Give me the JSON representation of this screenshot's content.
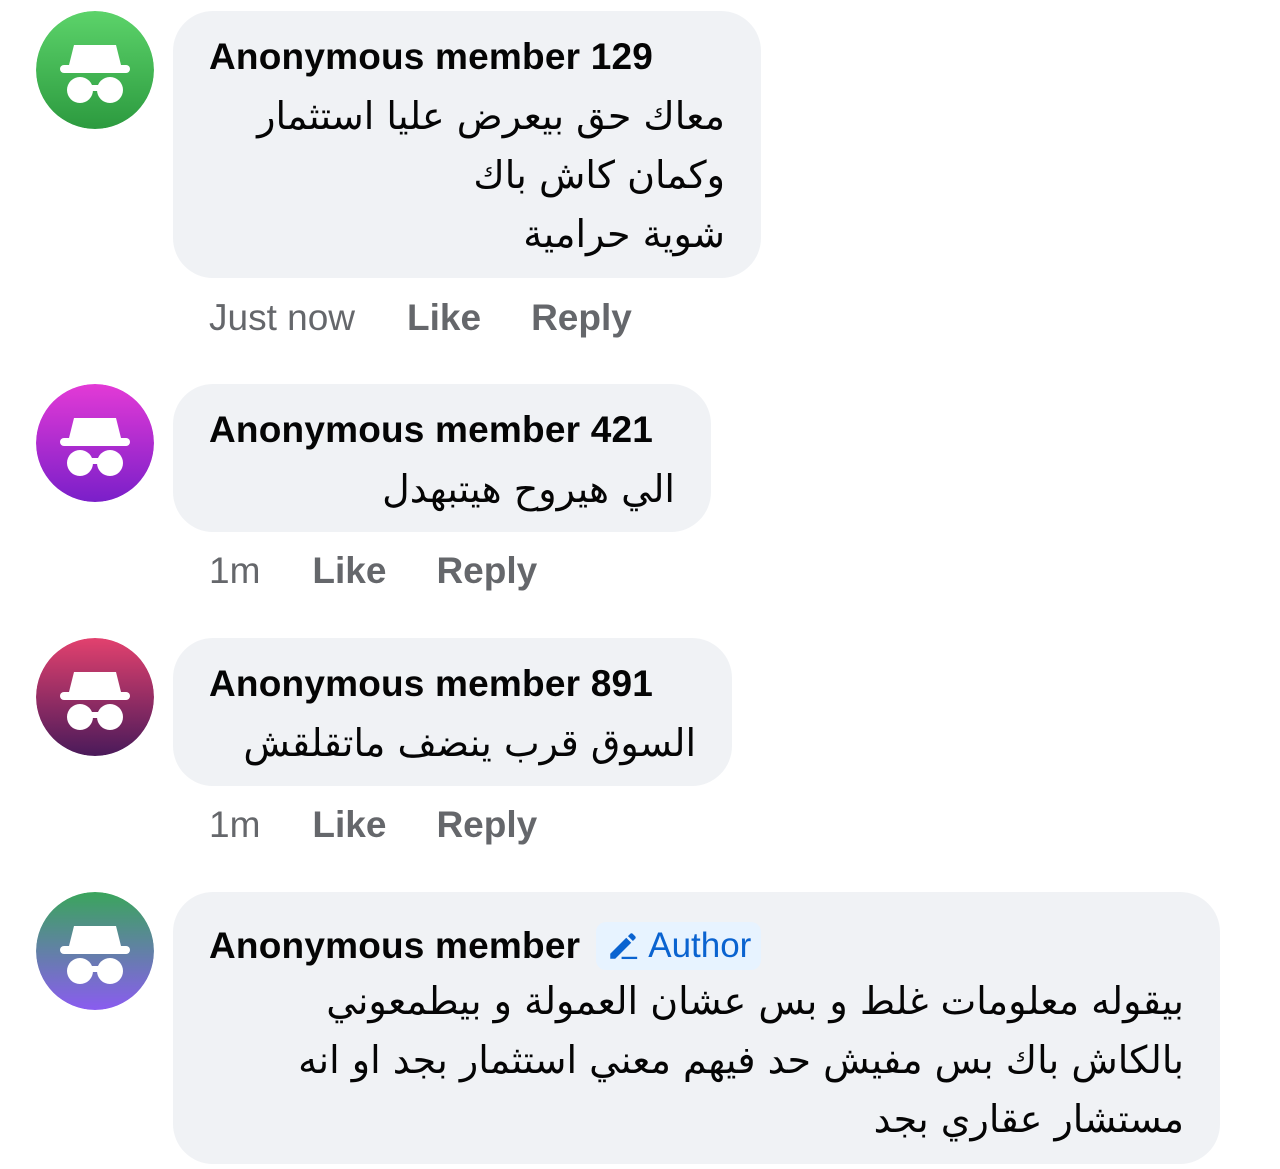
{
  "comments": [
    {
      "author": "Anonymous member 129",
      "lines": [
        "معاك حق بيعرض عليا استثمار",
        "وكمان كاش باك",
        "شوية حرامية"
      ],
      "time": "Just now",
      "like": "Like",
      "reply": "Reply",
      "avatar_colors": [
        "#5cd36a",
        "#2c9a3f"
      ]
    },
    {
      "author": "Anonymous member 421",
      "lines": [
        "الي هيروح هيتبهدل"
      ],
      "time": "1m",
      "like": "Like",
      "reply": "Reply",
      "avatar_colors": [
        "#e33ad6",
        "#7a1fc9"
      ]
    },
    {
      "author": "Anonymous member 891",
      "lines": [
        "السوق قرب ينضف ماتقلقش"
      ],
      "time": "1m",
      "like": "Like",
      "reply": "Reply",
      "avatar_colors": [
        "#e2416e",
        "#4a1a5a"
      ]
    },
    {
      "author": "Anonymous member",
      "badge": "Author",
      "lines": [
        "بيقوله معلومات غلط و بس عشان العمولة و بيطمعوني",
        "بالكاش باك بس مفيش حد فيهم معني استثمار بجد او انه",
        "مستشار عقاري بجد"
      ],
      "avatar_colors": [
        "#3aa55c",
        "#8a5cf0"
      ]
    }
  ],
  "icons": {
    "avatar": "incognito-hat-glasses-icon",
    "badge": "pencil-icon"
  },
  "colors": {
    "bubble": "#f0f2f5",
    "action_text": "#65676b",
    "badge_bg": "#e7f3ff",
    "badge_text": "#0a63d0"
  }
}
